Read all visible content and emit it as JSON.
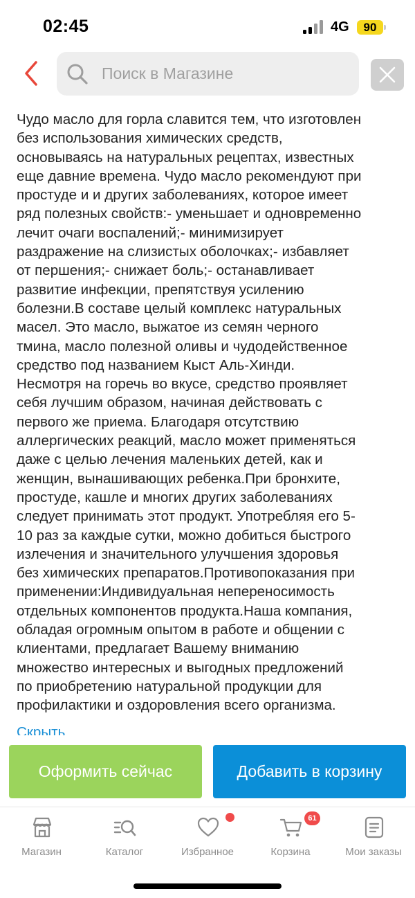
{
  "status_bar": {
    "time": "02:45",
    "network": "4G",
    "battery": "90"
  },
  "header": {
    "back_icon": "chevron-left-icon",
    "search_placeholder": "Поиск в Магазине",
    "close_icon": "close-icon"
  },
  "description": {
    "lines": [
      "Чудо масло для горла славится тем, что изготовлен",
      "без использования химических средств,",
      "основываясь на натуральных рецептах, известных",
      "еще давние времена. Чудо масло рекомендуют при",
      "простуде и и других заболеваниях, которое имеет",
      "ряд полезных свойств:- уменьшает и одновременно",
      "лечит очаги воспалений;- минимизирует",
      "раздражение на слизистых оболочках;- избавляет",
      "от першения;- снижает боль;- останавливает",
      "развитие инфекции, препятствуя усилению",
      "болезни.В составе целый комплекс натуральных",
      "масел. Это масло, выжатое из семян черного",
      "тмина, масло полезной оливы и чудодейственное",
      "средство под названием Кыст Аль-Хинди.",
      "Несмотря на горечь во вкусе, средство проявляет",
      "себя лучшим образом, начиная действовать с",
      "первого же приема. Благодаря отсутствию",
      "аллергических реакций, масло может применяться",
      "даже с целью лечения маленьких детей, как и",
      "женщин, вынашивающих ребенка.При бронхите,",
      "простуде, кашле и многих других заболеваниях",
      "следует принимать этот продукт. Употребляя его 5-",
      "10 раз за каждые сутки, можно добиться быстрого",
      "излечения и значительного улучшения здоровья",
      "без химических препаратов.Противопоказания при",
      "применении:Индивидуальная непереносимость",
      "отдельных компонентов продукта.Наша компания,",
      "обладая огромным опытом в работе и общении с",
      "клиентами, предлагает Вашему вниманию",
      "множество интересных и выгодных предложений",
      "по приобретению натуральной продукции для",
      "профилактики и оздоровления всего организма."
    ],
    "collapse_label": "Скрыть"
  },
  "actions": {
    "checkout_label": "Оформить сейчас",
    "add_to_cart_label": "Добавить в корзину",
    "checkout_color": "#9bd45c",
    "cart_color": "#0b8fd8"
  },
  "tabbar": {
    "items": [
      {
        "label": "Магазин",
        "icon": "store-icon"
      },
      {
        "label": "Каталог",
        "icon": "catalog-search-icon"
      },
      {
        "label": "Избранное",
        "icon": "heart-icon"
      },
      {
        "label": "Корзина",
        "icon": "cart-icon"
      },
      {
        "label": "Мои заказы",
        "icon": "orders-icon"
      }
    ],
    "cart_badge": "61"
  }
}
